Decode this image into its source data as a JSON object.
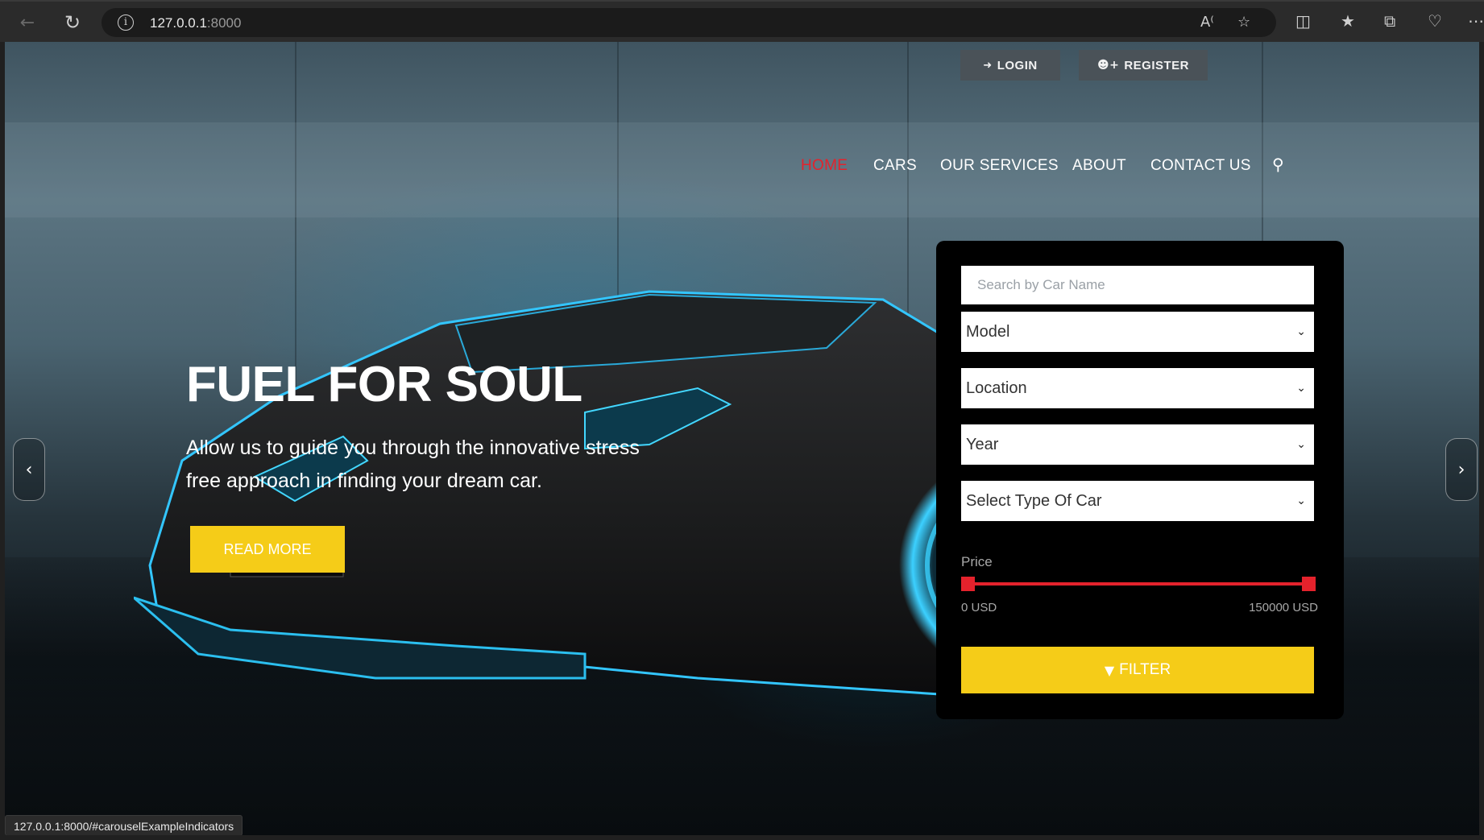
{
  "browser": {
    "url_host": "127.0.0.1",
    "url_port": ":8000",
    "status_url": "127.0.0.1:8000/#carouselExampleIndicators",
    "icons": [
      "back-icon",
      "reload-icon",
      "info-icon",
      "read-aloud-icon",
      "favorite-star-icon",
      "split-screen-icon",
      "favorites-icon",
      "collections-icon",
      "browser-essentials-icon",
      "more-icon"
    ]
  },
  "auth": {
    "login_label": "LOGIN",
    "register_label": "REGISTER"
  },
  "nav": {
    "items": [
      {
        "label": "HOME",
        "active": true
      },
      {
        "label": "CARS",
        "active": false
      },
      {
        "label": "OUR SERVICES",
        "active": false
      },
      {
        "label": "ABOUT",
        "active": false
      },
      {
        "label": "CONTACT US",
        "active": false
      }
    ],
    "search_icon": "search-icon"
  },
  "hero": {
    "title": "FUEL FOR SOUL",
    "text": "Allow us to guide you through the innovative stress free approach in finding your dream car.",
    "button_label": "READ MORE"
  },
  "filter": {
    "search_placeholder": "Search by Car Name",
    "model": "Model",
    "location": "Location",
    "year": "Year",
    "car_type": "Select Type Of Car",
    "price_label": "Price",
    "price_min": "0 USD",
    "price_max": "150000 USD",
    "button_label": "FILTER"
  },
  "colors": {
    "accent_yellow": "#f5cc18",
    "accent_red": "#e4222c",
    "panel_bg": "#000000",
    "button_gray": "#4a5258"
  }
}
